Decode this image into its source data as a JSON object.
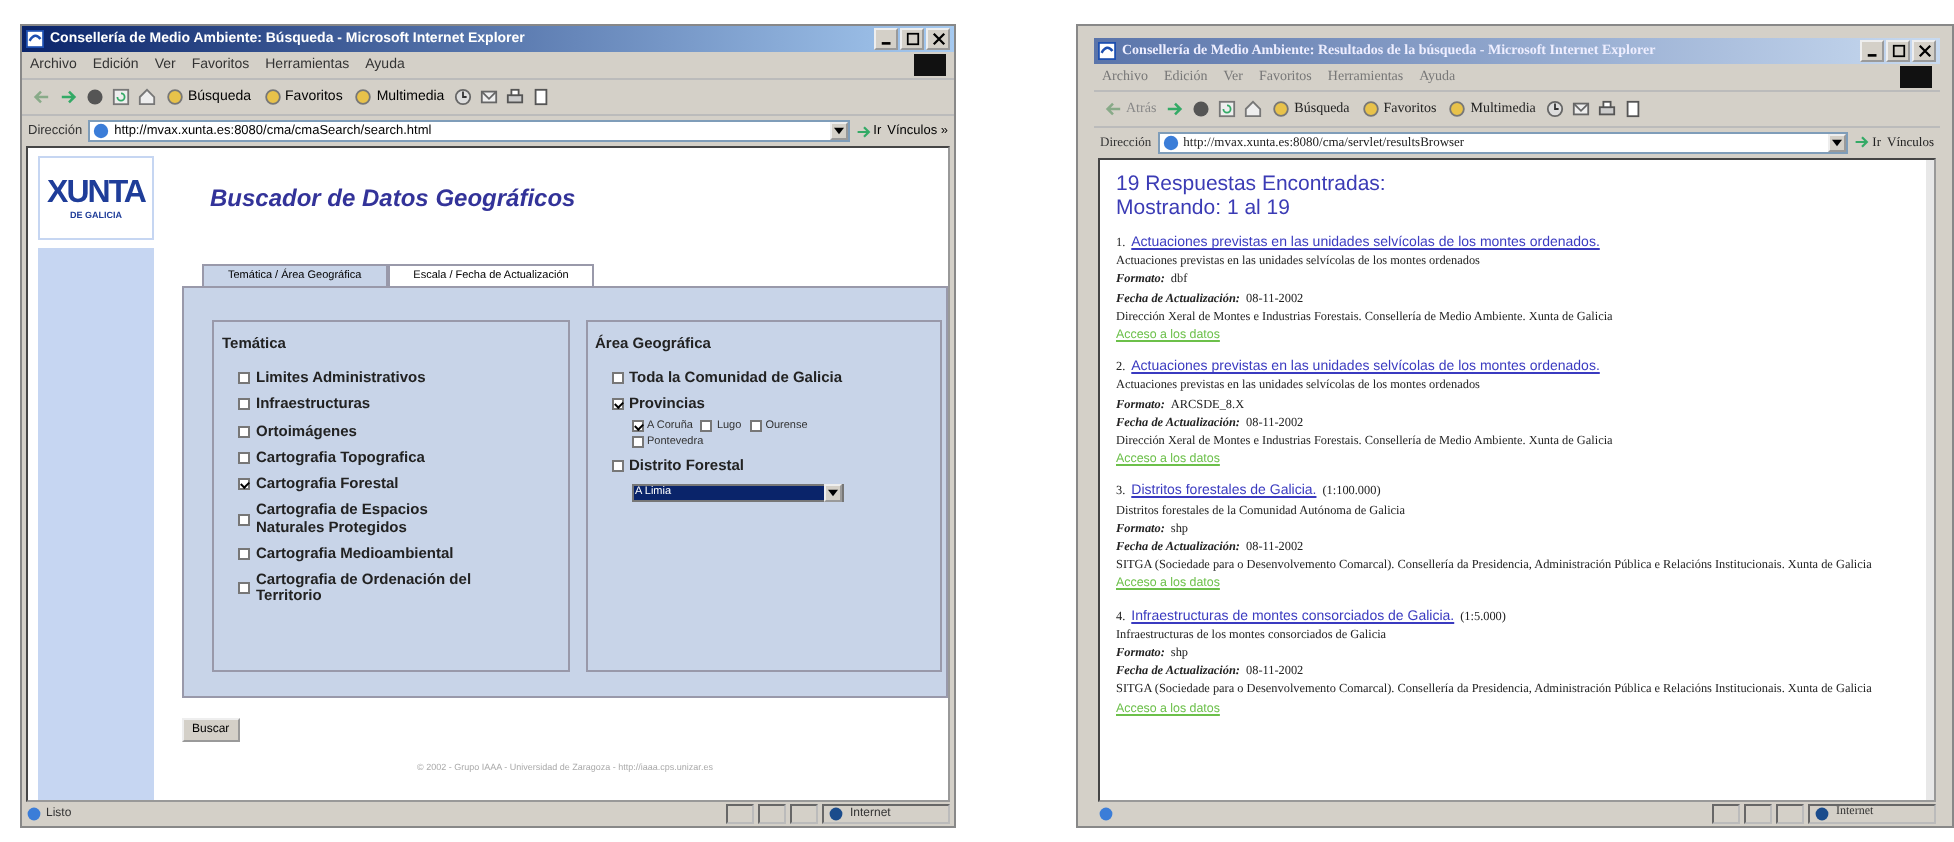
{
  "windows": [
    {
      "kind": "search",
      "title": "Consellería de Medio Ambiente: Búsqueda - Microsoft Internet Explorer",
      "menu": [
        "Archivo",
        "Edición",
        "Ver",
        "Favoritos",
        "Herramientas",
        "Ayuda"
      ],
      "toolbar": [
        "Búsqueda",
        "Favoritos",
        "Multimedia"
      ],
      "address": {
        "label": "Dirección",
        "url": "http://mvax.xunta.es:8080/cma/cmaSearch/search.html",
        "go": "Ir",
        "links": "Vínculos »"
      },
      "status": {
        "text": "Listo",
        "zone": "Internet"
      },
      "content": {
        "logo": {
          "word": "XUNTA",
          "sub": "DE GALICIA"
        },
        "heading": "Buscador de Datos Geográficos",
        "tabs": [
          {
            "label": "Temática / Área Geográfica",
            "selected": true
          },
          {
            "label": "Escala / Fecha de Actualización",
            "selected": false
          }
        ],
        "tematica": {
          "title": "Temática",
          "items": [
            {
              "label": "Limites Administrativos",
              "checked": false
            },
            {
              "label": "Infraestructuras",
              "checked": false
            },
            {
              "label": "Ortoimágenes",
              "checked": false
            },
            {
              "label": "Cartografia Topografica",
              "checked": false
            },
            {
              "label": "Cartografia Forestal",
              "checked": true
            },
            {
              "label": "Cartografia de Espacios Naturales Protegidos",
              "checked": false
            },
            {
              "label": "Cartografia Medioambiental",
              "checked": false
            },
            {
              "label": "Cartografia de Ordenación del Territorio",
              "checked": false
            }
          ]
        },
        "area": {
          "title": "Área Geográfica",
          "items": [
            {
              "label": "Toda la Comunidad de Galicia",
              "checked": false
            },
            {
              "label": "Provincias",
              "checked": true,
              "children": [
                {
                  "label": "A Coruña",
                  "checked": true
                },
                {
                  "label": "Lugo",
                  "checked": false
                },
                {
                  "label": "Ourense",
                  "checked": false
                },
                {
                  "label": "Pontevedra",
                  "checked": false
                }
              ]
            },
            {
              "label": "Distrito Forestal",
              "checked": false,
              "select": "A Limia"
            }
          ]
        },
        "submit": "Buscar",
        "footer": "© 2002 - Grupo IAAA - Universidad de Zaragoza - http://iaaa.cps.unizar.es"
      }
    },
    {
      "kind": "results",
      "title": "Consellería de Medio Ambiente: Resultados de la búsqueda - Microsoft Internet Explorer",
      "menu": [
        "Archivo",
        "Edición",
        "Ver",
        "Favoritos",
        "Herramientas",
        "Ayuda"
      ],
      "back": "Atrás",
      "toolbar": [
        "Búsqueda",
        "Favoritos",
        "Multimedia"
      ],
      "address": {
        "label": "Dirección",
        "url": "http://mvax.xunta.es:8080/cma/servlet/resultsBrowser",
        "go": "Ir",
        "links": "Vínculos"
      },
      "status": {
        "zone": "Internet"
      },
      "content": {
        "count": "19 Respuestas Encontradas:",
        "showing": "Mostrando:  1 al 19",
        "results": [
          {
            "num": "1.",
            "title": "Actuaciones previstas en las unidades selvícolas de los montes ordenados.",
            "description": "Actuaciones previstas en las unidades selvícolas de los montes ordenados",
            "format_label": "Formato:",
            "format": "dbf",
            "date_label": "Fecha de Actualización:",
            "date": "08-11-2002",
            "source": "Dirección Xeral de Montes e Industrias Forestais. Consellería de Medio Ambiente. Xunta de Galicia",
            "link": "Acceso a los datos"
          },
          {
            "num": "2.",
            "title": "Actuaciones previstas en las unidades selvícolas de los montes ordenados.",
            "description": "Actuaciones previstas en las unidades selvícolas de los montes ordenados",
            "format_label": "Formato:",
            "format": "ARCSDE_8.X",
            "date_label": "Fecha de Actualización:",
            "date": "08-11-2002",
            "source": "Dirección Xeral de Montes e Industrias Forestais. Consellería de Medio Ambiente. Xunta de Galicia",
            "link": "Acceso a los datos"
          },
          {
            "num": "3.",
            "title": "Distritos forestales de Galicia.",
            "scale": "(1:100.000)",
            "description": "Distritos forestales de la Comunidad Autónoma de Galicia",
            "format_label": "Formato:",
            "format": "shp",
            "date_label": "Fecha de Actualización:",
            "date": "08-11-2002",
            "source": "SITGA (Sociedade para o Desenvolvemento Comarcal). Consellería da Presidencia, Administración Pública e Relacións Institucionais. Xunta de Galicia",
            "link": "Acceso a los datos"
          },
          {
            "num": "4.",
            "title": "Infraestructuras de montes consorciados de Galicia.",
            "scale": "(1:5.000)",
            "description": "Infraestructuras de los montes consorciados de Galicia",
            "format_label": "Formato:",
            "format": "shp",
            "date_label": "Fecha de Actualización:",
            "date": "08-11-2002",
            "source": "SITGA (Sociedade para o Desenvolvemento Comarcal). Consellería da Presidencia, Administración Pública e Relacións Institucionais. Xunta de Galicia",
            "link": "Acceso a los datos"
          }
        ]
      }
    }
  ]
}
